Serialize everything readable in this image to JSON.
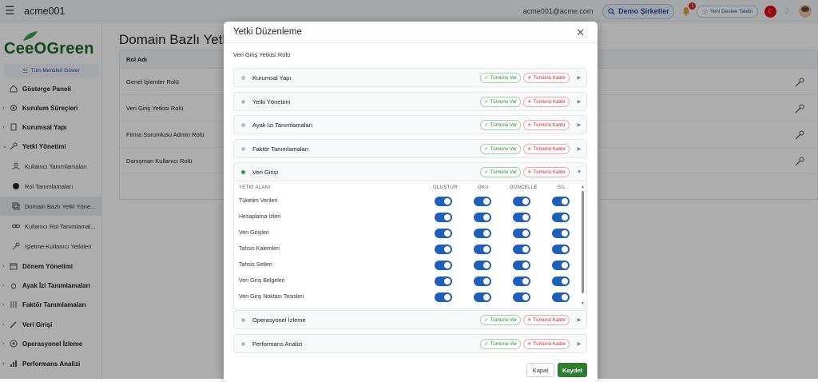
{
  "topbar": {
    "app_name": "acme001",
    "email": "acme001@acme.com",
    "company_button": "Demo Şirketler",
    "notification_count": "1",
    "support_button": "Yeni Destek Talebi"
  },
  "sidebar": {
    "logo_text": "CeeOGreen",
    "show_all_menus": "Tüm Menüleri Göster",
    "items": [
      {
        "label": "Gösterge Paneli"
      },
      {
        "label": "Kurulum Süreçleri"
      },
      {
        "label": "Kurumsal Yapı"
      },
      {
        "label": "Yetki Yönetimi"
      },
      {
        "label": "Kullanıcı Tanımlamaları"
      },
      {
        "label": "Rol Tanımlamaları"
      },
      {
        "label": "Domain Bazlı Yetki Yöne..."
      },
      {
        "label": "Kullanıcı Rol Tanımlamal..."
      },
      {
        "label": "İşletme-Kullanıcı Yetkileri"
      },
      {
        "label": "Dönem Yönetimi"
      },
      {
        "label": "Ayak İzi Tanımlamaları"
      },
      {
        "label": "Faktör Tanımlamaları"
      },
      {
        "label": "Veri Girişi"
      },
      {
        "label": "Operasyonel İzleme"
      },
      {
        "label": "Performans Analizi"
      }
    ]
  },
  "main": {
    "title": "Domain Bazlı Yetki",
    "column_header": "Rol Adı",
    "rows": [
      "Genel İşlemler Rolü",
      "Veri Giriş Yetkisi Rolü",
      "Firma Sorumlusu Admin Rolü",
      "Danışman Kullanıcı Rolü"
    ]
  },
  "modal": {
    "title": "Yetki Düzenleme",
    "subtitle": "Veri Giriş Yetkisi Rolü",
    "grant_all": "Tümünü Ver",
    "revoke_all": "Tümünü Kaldır",
    "sections": [
      "Kurumsal Yapı",
      "Yetki Yönetimi",
      "Ayak İzi Tanımlamaları",
      "Faktör Tanımlamaları",
      "Veri Girişi",
      "Operasyonel İzleme",
      "Performans Analizi"
    ],
    "grid_headers": {
      "area": "YETKİ ALANI",
      "create": "OLUŞTUR",
      "read": "OKU",
      "update": "GÜNCELLE",
      "delete": "SİL"
    },
    "grid_rows": [
      "Tüketim Verileri",
      "Hesaplama İzleri",
      "Veri Girişleri",
      "Tahsis Kalemleri",
      "Tahsis Setleri",
      "Veri Giriş Belgeleri",
      "Veri Giriş Noktası Tesisleri"
    ],
    "cancel": "Kapat",
    "save": "Kaydet"
  },
  "colors": {
    "brand_green": "#1b6b2f",
    "toggle_blue": "#1f5fb8",
    "save_green": "#2f7d32"
  }
}
